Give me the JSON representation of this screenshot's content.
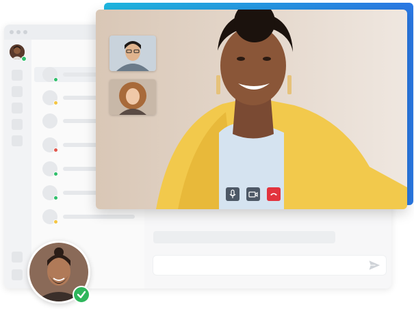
{
  "window": {
    "dots": [
      "window-dot",
      "window-dot",
      "window-dot"
    ]
  },
  "sidebar": {
    "rail_items": [
      "rail-item",
      "rail-item",
      "rail-item",
      "rail-item",
      "rail-item"
    ],
    "bottom_rail_items": [
      "rail-item",
      "rail-item"
    ]
  },
  "contacts": [
    {
      "status_color": "#2fbf6b",
      "active": true
    },
    {
      "status_color": "#f4c542",
      "active": false
    },
    {
      "status_color": null,
      "active": false
    },
    {
      "status_color": "#e2574c",
      "active": false
    },
    {
      "status_color": "#2fbf6b",
      "active": false
    },
    {
      "status_color": "#2fbf6b",
      "active": false
    },
    {
      "status_color": "#f4c542",
      "active": false
    }
  ],
  "call_controls": [
    {
      "name": "microphone",
      "icon": "microphone-icon",
      "color": "#4d5866"
    },
    {
      "name": "video",
      "icon": "video-camera-icon",
      "color": "#4d5866"
    },
    {
      "name": "end-call",
      "icon": "phone-hangup-icon",
      "color": "#e2333d"
    }
  ],
  "participants": [
    {
      "name": "participant-man-glasses"
    },
    {
      "name": "participant-woman-curly-hair"
    }
  ],
  "colors": {
    "accent_gradient_start": "#1fb6e0",
    "accent_gradient_end": "#2a78e4",
    "online": "#2fbf6b",
    "away": "#f4c542",
    "busy": "#e2574c",
    "verified_badge": "#2fb65c"
  },
  "icons": {
    "send": "send-icon",
    "verified": "check-icon"
  }
}
